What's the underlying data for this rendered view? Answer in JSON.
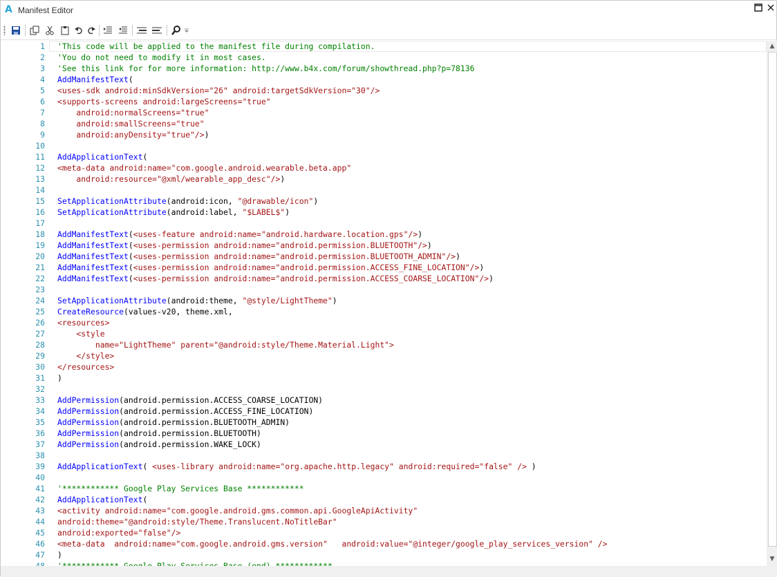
{
  "window": {
    "title": "Manifest Editor",
    "app_icon_letter": "A"
  },
  "toolbar": {
    "buttons": [
      {
        "name": "save-icon"
      },
      {
        "name": "copy-icon"
      },
      {
        "name": "cut-icon"
      },
      {
        "name": "paste-icon"
      },
      {
        "name": "undo-icon"
      },
      {
        "name": "redo-icon"
      },
      {
        "name": "indent-icon"
      },
      {
        "name": "outdent-icon"
      },
      {
        "name": "comment-block-icon"
      },
      {
        "name": "uncomment-block-icon"
      },
      {
        "name": "find-icon"
      }
    ]
  },
  "lines": [
    [
      [
        "comment",
        "'This code will be applied to the manifest file during compilation."
      ]
    ],
    [
      [
        "comment",
        "'You do not need to modify it in most cases."
      ]
    ],
    [
      [
        "comment",
        "'See this link for for more information: http://www.b4x.com/forum/showthread.php?p=78136"
      ]
    ],
    [
      [
        "kw",
        "AddManifestText"
      ],
      [
        "plain",
        "("
      ]
    ],
    [
      [
        "str",
        "<uses-sdk android:minSdkVersion=\"26\" android:targetSdkVersion=\"30\"/>"
      ]
    ],
    [
      [
        "str",
        "<supports-screens android:largeScreens=\"true\""
      ]
    ],
    [
      [
        "str",
        "    android:normalScreens=\"true\""
      ]
    ],
    [
      [
        "str",
        "    android:smallScreens=\"true\""
      ]
    ],
    [
      [
        "str",
        "    android:anyDensity=\"true\"/>"
      ],
      [
        "plain",
        ")"
      ]
    ],
    [],
    [
      [
        "kw",
        "AddApplicationText"
      ],
      [
        "plain",
        "("
      ]
    ],
    [
      [
        "str",
        "<meta-data android:name=\"com.google.android.wearable.beta.app\""
      ]
    ],
    [
      [
        "str",
        "    android:resource=\"@xml/wearable_app_desc\"/>"
      ],
      [
        "plain",
        ")"
      ]
    ],
    [],
    [
      [
        "kw",
        "SetApplicationAttribute"
      ],
      [
        "plain",
        "(android:icon, "
      ],
      [
        "str",
        "\"@drawable/icon\""
      ],
      [
        "plain",
        ")"
      ]
    ],
    [
      [
        "kw",
        "SetApplicationAttribute"
      ],
      [
        "plain",
        "(android:label, "
      ],
      [
        "str",
        "\"$LABEL$\""
      ],
      [
        "plain",
        ")"
      ]
    ],
    [],
    [
      [
        "kw",
        "AddManifestText"
      ],
      [
        "plain",
        "("
      ],
      [
        "str",
        "<uses-feature android:name=\"android.hardware.location.gps\"/>"
      ],
      [
        "plain",
        ")"
      ]
    ],
    [
      [
        "kw",
        "AddManifestText"
      ],
      [
        "plain",
        "("
      ],
      [
        "str",
        "<uses-permission android:name=\"android.permission.BLUETOOTH\"/>"
      ],
      [
        "plain",
        ")"
      ]
    ],
    [
      [
        "kw",
        "AddManifestText"
      ],
      [
        "plain",
        "("
      ],
      [
        "str",
        "<uses-permission android:name=\"android.permission.BLUETOOTH_ADMIN\"/>"
      ],
      [
        "plain",
        ")"
      ]
    ],
    [
      [
        "kw",
        "AddManifestText"
      ],
      [
        "plain",
        "("
      ],
      [
        "str",
        "<uses-permission android:name=\"android.permission.ACCESS_FINE_LOCATION\"/>"
      ],
      [
        "plain",
        ")"
      ]
    ],
    [
      [
        "kw",
        "AddManifestText"
      ],
      [
        "plain",
        "("
      ],
      [
        "str",
        "<uses-permission android:name=\"android.permission.ACCESS_COARSE_LOCATION\"/>"
      ],
      [
        "plain",
        ")"
      ]
    ],
    [],
    [
      [
        "kw",
        "SetApplicationAttribute"
      ],
      [
        "plain",
        "(android:theme, "
      ],
      [
        "str",
        "\"@style/LightTheme\""
      ],
      [
        "plain",
        ")"
      ]
    ],
    [
      [
        "kw",
        "CreateResource"
      ],
      [
        "plain",
        "(values-v20, theme.xml,"
      ]
    ],
    [
      [
        "str",
        "<resources>"
      ]
    ],
    [
      [
        "str",
        "    <style"
      ]
    ],
    [
      [
        "str",
        "        name=\"LightTheme\" parent=\"@android:style/Theme.Material.Light\">"
      ]
    ],
    [
      [
        "str",
        "    </style>"
      ]
    ],
    [
      [
        "str",
        "</resources>"
      ]
    ],
    [
      [
        "plain",
        ")"
      ]
    ],
    [],
    [
      [
        "kw",
        "AddPermission"
      ],
      [
        "plain",
        "(android.permission.ACCESS_COARSE_LOCATION)"
      ]
    ],
    [
      [
        "kw",
        "AddPermission"
      ],
      [
        "plain",
        "(android.permission.ACCESS_FINE_LOCATION)"
      ]
    ],
    [
      [
        "kw",
        "AddPermission"
      ],
      [
        "plain",
        "(android.permission.BLUETOOTH_ADMIN)"
      ]
    ],
    [
      [
        "kw",
        "AddPermission"
      ],
      [
        "plain",
        "(android.permission.BLUETOOTH)"
      ]
    ],
    [
      [
        "kw",
        "AddPermission"
      ],
      [
        "plain",
        "(android.permission.WAKE_LOCK)"
      ]
    ],
    [],
    [
      [
        "kw",
        "AddApplicationText"
      ],
      [
        "plain",
        "( "
      ],
      [
        "str",
        "<uses-library android:name=\"org.apache.http.legacy\" android:required=\"false\" />"
      ],
      [
        "plain",
        " )"
      ]
    ],
    [],
    [
      [
        "comment",
        "'************ Google Play Services Base ************"
      ]
    ],
    [
      [
        "kw",
        "AddApplicationText"
      ],
      [
        "plain",
        "("
      ]
    ],
    [
      [
        "str",
        "<activity android:name=\"com.google.android.gms.common.api.GoogleApiActivity\""
      ]
    ],
    [
      [
        "str",
        "android:theme=\"@android:style/Theme.Translucent.NoTitleBar\""
      ]
    ],
    [
      [
        "str",
        "android:exported=\"false\"/>"
      ]
    ],
    [
      [
        "str",
        "<meta-data  android:name=\"com.google.android.gms.version\"   android:value=\"@integer/google_play_services_version\" />"
      ]
    ],
    [
      [
        "plain",
        ")"
      ]
    ],
    [
      [
        "comment",
        "'************ Google Play Services Base (end) ************"
      ]
    ]
  ]
}
